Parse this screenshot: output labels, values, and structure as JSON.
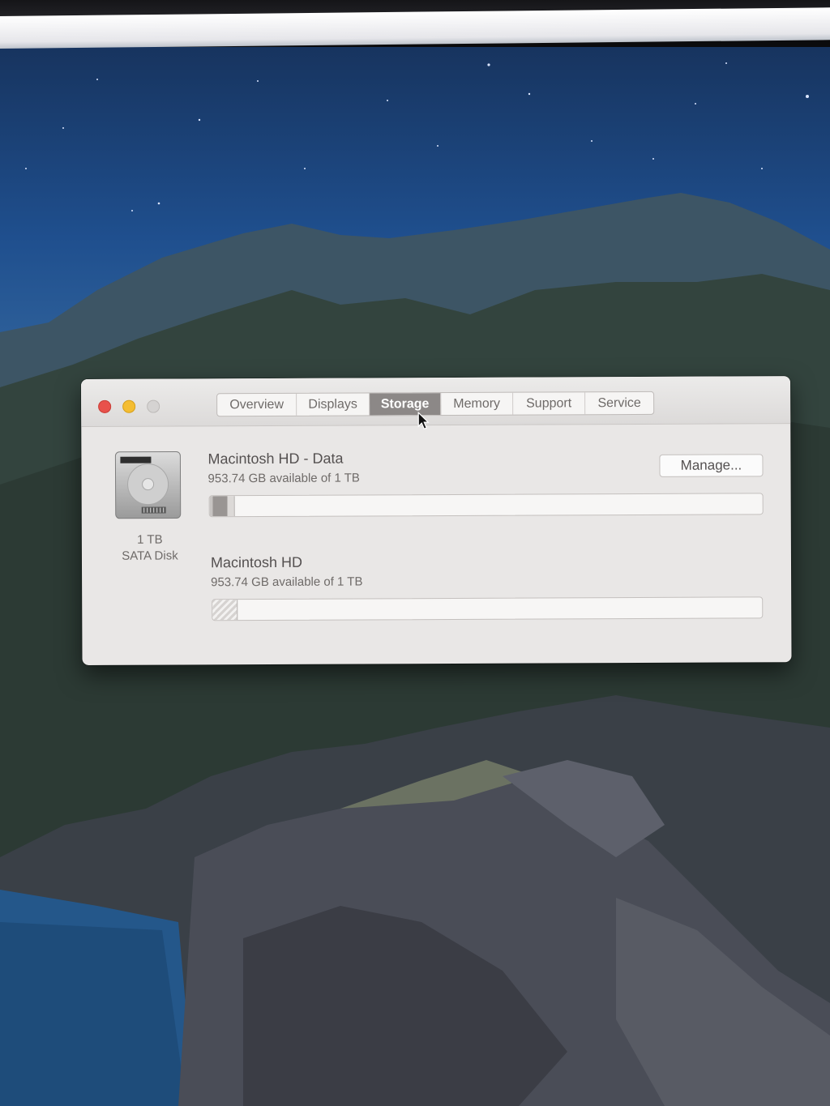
{
  "window": {
    "tabs": [
      {
        "label": "Overview"
      },
      {
        "label": "Displays"
      },
      {
        "label": "Storage"
      },
      {
        "label": "Memory"
      },
      {
        "label": "Support"
      },
      {
        "label": "Service"
      }
    ],
    "selected_tab": "Storage"
  },
  "disk": {
    "size": "1 TB",
    "type": "SATA Disk",
    "icon": "hard-disk-icon"
  },
  "volumes": [
    {
      "name": "Macintosh HD - Data",
      "available": "953.74 GB available of 1 TB",
      "used_fraction": 0.046
    },
    {
      "name": "Macintosh HD",
      "available": "953.74 GB available of 1 TB",
      "used_fraction": 0.046
    }
  ],
  "actions": {
    "manage_label": "Manage..."
  },
  "colors": {
    "close": "#e8514b",
    "minimize": "#f4bd32",
    "zoom_inactive": "#d5d3d2",
    "selected_tab": "#8c8887"
  }
}
